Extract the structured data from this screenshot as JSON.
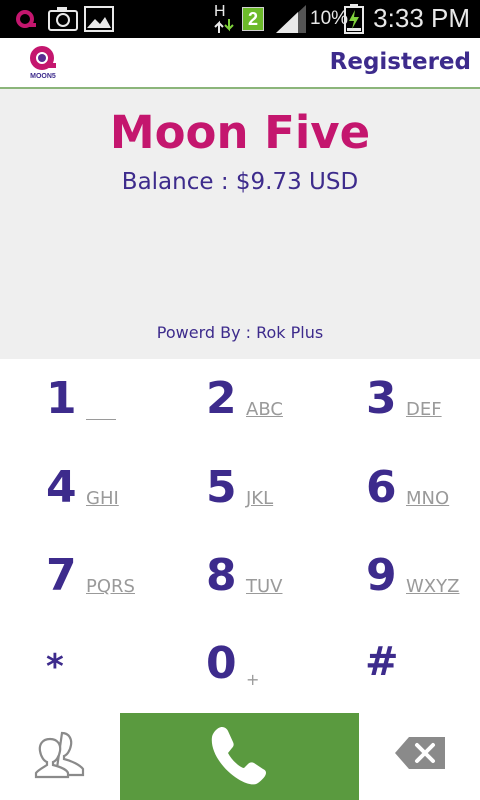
{
  "status_bar": {
    "network_type": "H",
    "notification_count": "2",
    "battery_percent": "10%",
    "time": "3:33 PM",
    "icons": [
      "app-notification-icon",
      "camera-icon",
      "gallery-icon",
      "data-arrows-icon",
      "notification-badge-icon",
      "signal-icon",
      "battery-charging-icon"
    ]
  },
  "header": {
    "logo_text": "MOON5",
    "status": "Registered"
  },
  "info": {
    "brand": "Moon Five",
    "balance": "Balance : $9.73 USD",
    "powered_by": "Powerd By : Rok Plus"
  },
  "keypad": {
    "keys": [
      {
        "digit": "1",
        "letters": ""
      },
      {
        "digit": "2",
        "letters": "ABC"
      },
      {
        "digit": "3",
        "letters": "DEF"
      },
      {
        "digit": "4",
        "letters": "GHI"
      },
      {
        "digit": "5",
        "letters": "JKL"
      },
      {
        "digit": "6",
        "letters": "MNO"
      },
      {
        "digit": "7",
        "letters": "PQRS"
      },
      {
        "digit": "8",
        "letters": "TUV"
      },
      {
        "digit": "9",
        "letters": "WXYZ"
      },
      {
        "digit": "*",
        "letters": ""
      },
      {
        "digit": "0",
        "letters": "+"
      },
      {
        "digit": "#",
        "letters": ""
      }
    ]
  },
  "bottom_bar": {
    "contacts_icon": "contacts-icon",
    "call_icon": "phone-icon",
    "backspace_icon": "backspace-icon"
  },
  "colors": {
    "brand_magenta": "#c4166e",
    "text_purple": "#3d2b8c",
    "call_green": "#5a9a3f",
    "panel_gray": "#efefef",
    "header_line": "#8bb57a"
  }
}
